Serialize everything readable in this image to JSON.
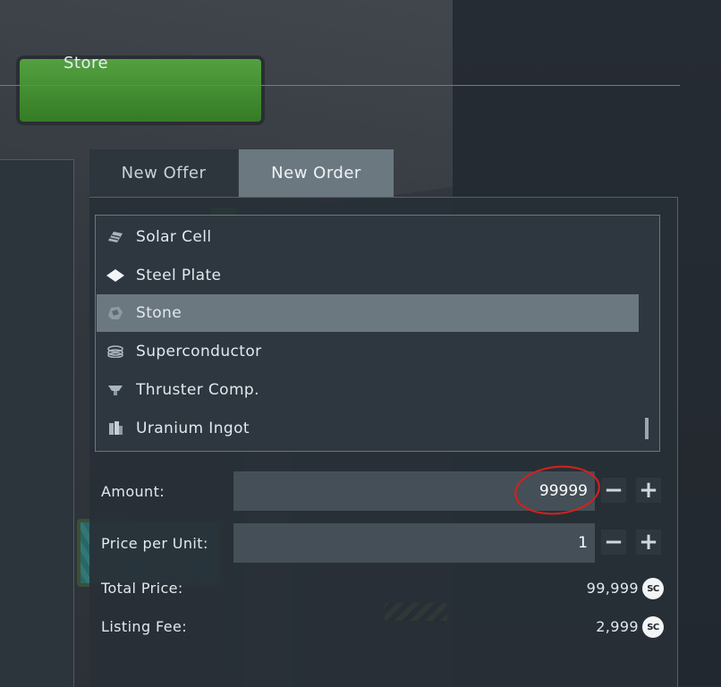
{
  "window": {
    "title": "Store"
  },
  "tabs": [
    {
      "label": "New Offer",
      "active": false
    },
    {
      "label": "New Order",
      "active": true
    }
  ],
  "items": [
    {
      "label": "Solar Cell",
      "icon": "solar-cell-icon",
      "selected": false
    },
    {
      "label": "Steel Plate",
      "icon": "steel-plate-icon",
      "selected": false
    },
    {
      "label": "Stone",
      "icon": "stone-icon",
      "selected": true
    },
    {
      "label": "Superconductor",
      "icon": "superconductor-icon",
      "selected": false
    },
    {
      "label": "Thruster Comp.",
      "icon": "thruster-comp-icon",
      "selected": false
    },
    {
      "label": "Uranium Ingot",
      "icon": "uranium-ingot-icon",
      "selected": false
    }
  ],
  "form": {
    "amount_label": "Amount:",
    "amount_value": "99999",
    "price_label": "Price per Unit:",
    "price_value": "1",
    "minus": "−",
    "plus": "+"
  },
  "summary": {
    "total_label": "Total Price:",
    "total_value": "99,999",
    "fee_label": "Listing Fee:",
    "fee_value": "2,999",
    "currency_symbol": "SC"
  },
  "colors": {
    "selected_row": "#6b7880",
    "active_tab": "#6b7880",
    "annotation": "#d9201c"
  }
}
